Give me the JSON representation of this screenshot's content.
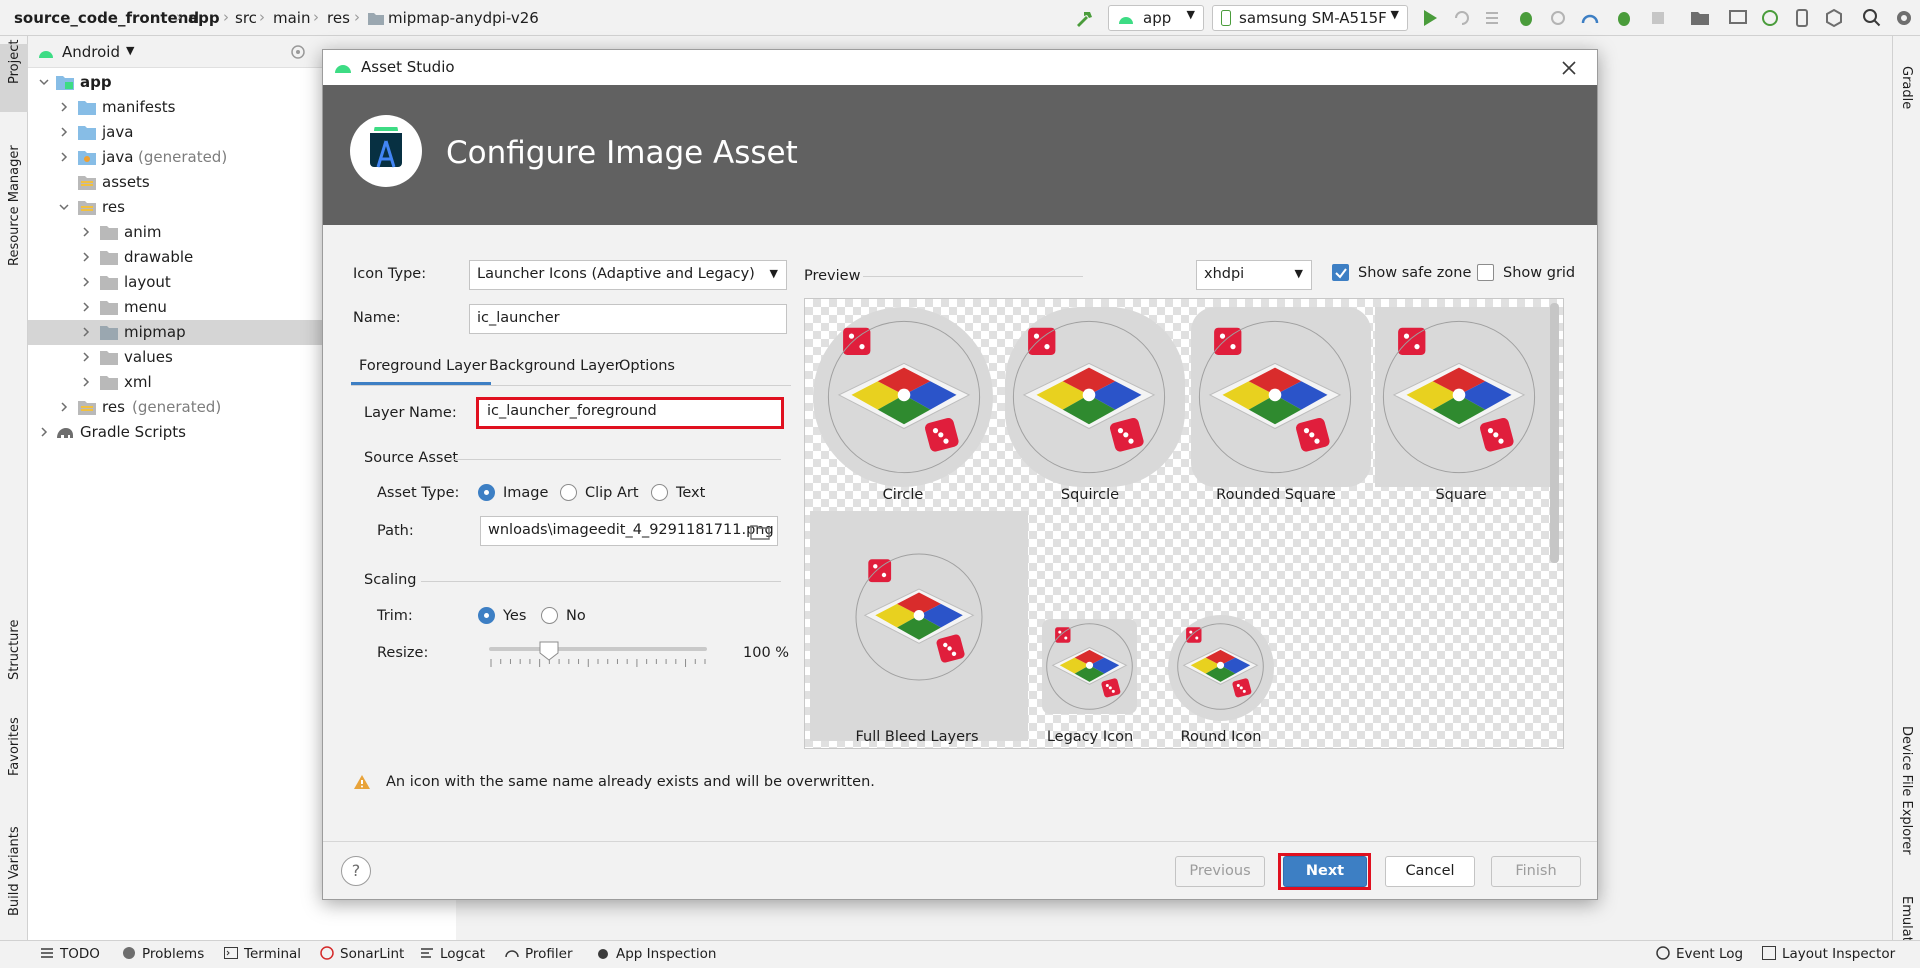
{
  "breadcrumb": {
    "items": [
      "source_code_frontend",
      "app",
      "src",
      "main",
      "res",
      "mipmap-anydpi-v26"
    ]
  },
  "toolbar": {
    "run_config": "app",
    "device": "samsung SM-A515F"
  },
  "left_tool_tabs": [
    "Project",
    "Resource Manager",
    "Structure",
    "Favorites",
    "Build Variants"
  ],
  "right_tool_tabs": [
    "Gradle",
    "Device File Explorer",
    "Emulator"
  ],
  "project_panel": {
    "view_selector": "Android",
    "tree": [
      {
        "label": "app",
        "suffix": ""
      },
      {
        "label": "manifests",
        "suffix": ""
      },
      {
        "label": "java",
        "suffix": ""
      },
      {
        "label": "java",
        "suffix": "(generated)"
      },
      {
        "label": "assets",
        "suffix": ""
      },
      {
        "label": "res",
        "suffix": ""
      },
      {
        "label": "anim",
        "suffix": ""
      },
      {
        "label": "drawable",
        "suffix": ""
      },
      {
        "label": "layout",
        "suffix": ""
      },
      {
        "label": "menu",
        "suffix": ""
      },
      {
        "label": "mipmap",
        "suffix": ""
      },
      {
        "label": "values",
        "suffix": ""
      },
      {
        "label": "xml",
        "suffix": ""
      },
      {
        "label": "res",
        "suffix": "(generated)"
      },
      {
        "label": "Gradle Scripts",
        "suffix": ""
      }
    ]
  },
  "dialog": {
    "title": "Asset Studio",
    "heading": "Configure Image Asset",
    "icon_type_label": "Icon Type:",
    "icon_type_value": "Launcher Icons (Adaptive and Legacy)",
    "name_label": "Name:",
    "name_value": "ic_launcher",
    "tabs": [
      "Foreground Layer",
      "Background Layer",
      "Options"
    ],
    "layer_name_label": "Layer Name:",
    "layer_name_value": "ic_launcher_foreground",
    "source_asset_title": "Source Asset",
    "asset_type_label": "Asset Type:",
    "asset_type_options": [
      "Image",
      "Clip Art",
      "Text"
    ],
    "path_label": "Path:",
    "path_value": "wnloads\\imageedit_4_9291181711.png",
    "scaling_title": "Scaling",
    "trim_label": "Trim:",
    "trim_options": [
      "Yes",
      "No"
    ],
    "resize_label": "Resize:",
    "resize_value": "100 %",
    "resize_fraction": 0.2,
    "preview_label": "Preview",
    "density_value": "xhdpi",
    "show_safe_zone": "Show safe zone",
    "show_grid": "Show grid",
    "preview_items": [
      "Circle",
      "Squircle",
      "Rounded Square",
      "Square",
      "Full Bleed Layers",
      "Legacy Icon",
      "Round Icon"
    ],
    "warning": "An icon with the same name already exists and will be overwritten.",
    "buttons": {
      "help": "?",
      "previous": "Previous",
      "next": "Next",
      "cancel": "Cancel",
      "finish": "Finish"
    }
  },
  "bottom_bar": [
    "TODO",
    "Problems",
    "Terminal",
    "SonarLint",
    "Logcat",
    "Profiler",
    "App Inspection",
    "Event Log",
    "Layout Inspector"
  ],
  "colors": {
    "accent": "#3d7fc4",
    "highlight_frame": "#e0101f",
    "banner": "#616161",
    "warning": "#e8a33a"
  }
}
